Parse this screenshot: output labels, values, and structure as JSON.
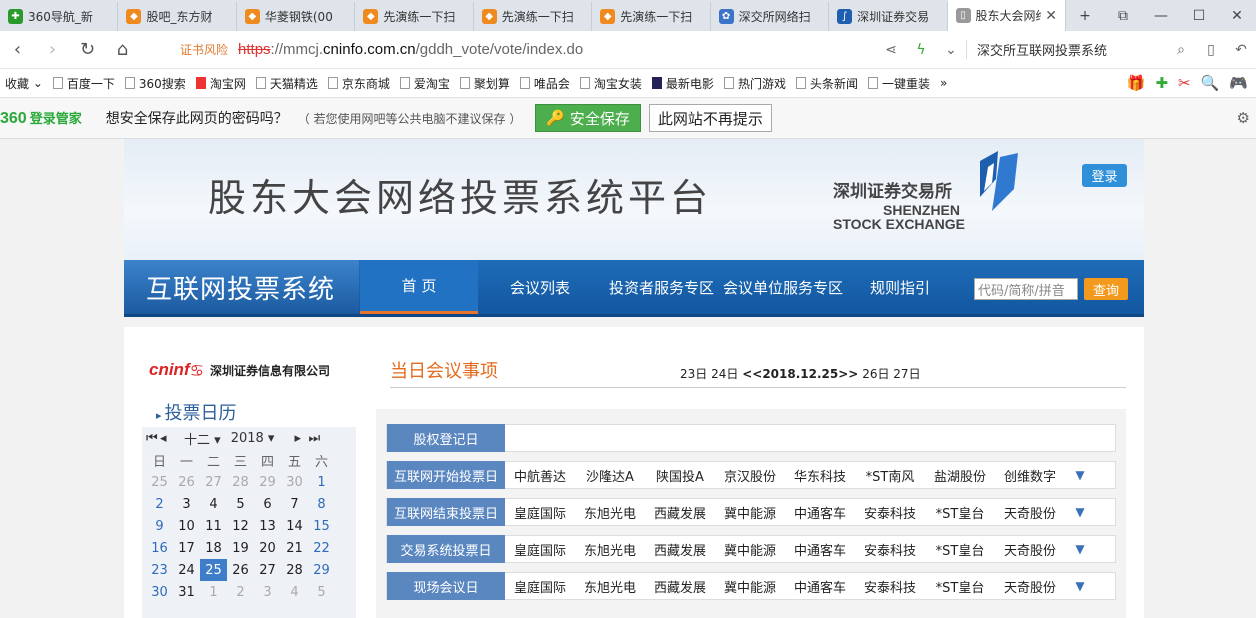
{
  "tabs": [
    {
      "label": "360导航_新",
      "color": "#2a9a2a",
      "glyph": "✚"
    },
    {
      "label": "股吧_东方财",
      "color": "#ef8a1e",
      "glyph": "◆"
    },
    {
      "label": "华菱钢铁(00",
      "color": "#ef8a1e",
      "glyph": "◆"
    },
    {
      "label": "先演练一下扫",
      "color": "#ef8a1e",
      "glyph": "◆"
    },
    {
      "label": "先演练一下扫",
      "color": "#ef8a1e",
      "glyph": "◆"
    },
    {
      "label": "先演练一下扫",
      "color": "#ef8a1e",
      "glyph": "◆"
    },
    {
      "label": "深交所网络扫",
      "color": "#3b74c8",
      "glyph": "✿"
    },
    {
      "label": "深圳证券交易",
      "color": "#1f5faf",
      "glyph": "∫"
    },
    {
      "label": "股东大会网络",
      "color": "#999999",
      "glyph": "▯"
    }
  ],
  "address": {
    "cert_warning": "证书风险",
    "url_scheme": "https",
    "url_prefix": "://mmcj.",
    "url_host": "cninfo.com.cn",
    "url_path": "/gddh_vote/vote/index.do",
    "search_text": "深交所互联网投票系统"
  },
  "favorites": {
    "collect_label": "收藏",
    "items": [
      "百度一下",
      "360搜索",
      "淘宝网",
      "天猫精选",
      "京东商城",
      "爱淘宝",
      "聚划算",
      "唯品会",
      "淘宝女装",
      "最新电影",
      "热门游戏",
      "头条新闻",
      "一键重装"
    ],
    "more": "»"
  },
  "password_bar": {
    "brand": "360",
    "brand_sub": "登录管家",
    "question": "想安全保存此网页的密码吗？",
    "note": "（ 若您使用网吧等公共电脑不建议保存 ）",
    "save_label": "安全保存",
    "never_label": "此网站不再提示"
  },
  "banner": {
    "title": "股东大会网络投票系统平台",
    "exchange_cn": "深圳证券交易所",
    "exchange_en1": "SHENZHEN",
    "exchange_en2": "STOCK EXCHANGE",
    "login_label": "登录"
  },
  "nav": {
    "brand": "互联网投票系统",
    "items": [
      "首 页",
      "会议列表",
      "投资者服务专区",
      "会议单位服务专区",
      "规则指引"
    ],
    "search_placeholder": "代码/简称/拼音",
    "query_label": "查询"
  },
  "sidebar": {
    "cninfo_logo": "cninf",
    "cninfo_company": "深圳证券信息有限公司",
    "calendar_title": "投票日历",
    "month": "十二",
    "year": "2018",
    "weekdays": [
      "日",
      "一",
      "二",
      "三",
      "四",
      "五",
      "六"
    ],
    "days": [
      [
        "25",
        "26",
        "27",
        "28",
        "29",
        "30",
        "1"
      ],
      [
        "2",
        "3",
        "4",
        "5",
        "6",
        "7",
        "8"
      ],
      [
        "9",
        "10",
        "11",
        "12",
        "13",
        "14",
        "15"
      ],
      [
        "16",
        "17",
        "18",
        "19",
        "20",
        "21",
        "22"
      ],
      [
        "23",
        "24",
        "25",
        "26",
        "27",
        "28",
        "29"
      ],
      [
        "30",
        "31",
        "1",
        "2",
        "3",
        "4",
        "5"
      ]
    ],
    "selected_day": "25"
  },
  "meetings": {
    "title": "当日会议事项",
    "dates": {
      "d1": "23日",
      "d2": "24日",
      "current": "<<2018.12.25>>",
      "d4": "26日",
      "d5": "27日"
    },
    "rows": [
      {
        "label": "股权登记日",
        "companies": []
      },
      {
        "label": "互联网开始投票日",
        "companies": [
          "中航善达",
          "沙隆达A",
          "陕国投A",
          "京汉股份",
          "华东科技",
          "*ST南风",
          "盐湖股份",
          "创维数字"
        ]
      },
      {
        "label": "互联网结束投票日",
        "companies": [
          "皇庭国际",
          "东旭光电",
          "西藏发展",
          "冀中能源",
          "中通客车",
          "安泰科技",
          "*ST皇台",
          "天奇股份"
        ]
      },
      {
        "label": "交易系统投票日",
        "companies": [
          "皇庭国际",
          "东旭光电",
          "西藏发展",
          "冀中能源",
          "中通客车",
          "安泰科技",
          "*ST皇台",
          "天奇股份"
        ]
      },
      {
        "label": "现场会议日",
        "companies": [
          "皇庭国际",
          "东旭光电",
          "西藏发展",
          "冀中能源",
          "中通客车",
          "安泰科技",
          "*ST皇台",
          "天奇股份"
        ]
      }
    ],
    "more_glyph": "▼"
  }
}
